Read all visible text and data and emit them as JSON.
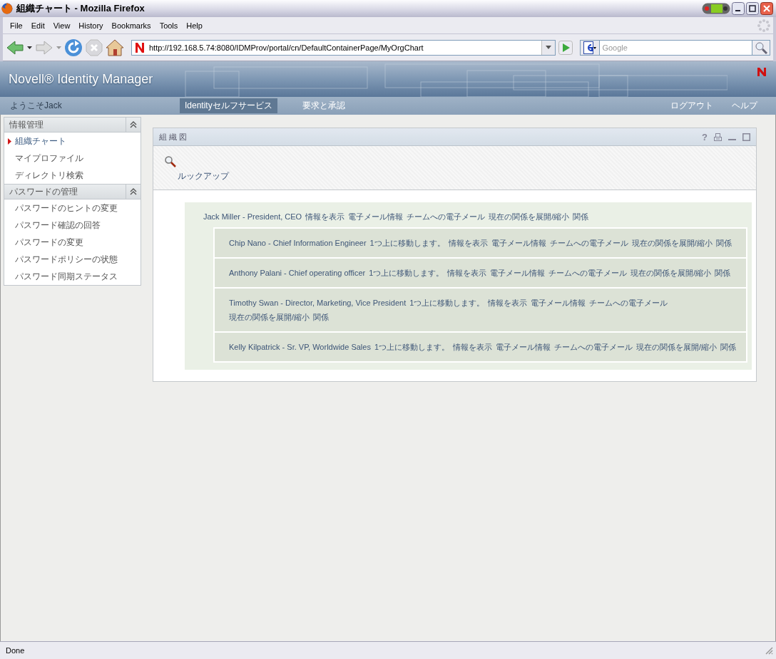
{
  "window": {
    "title": "組織チャート - Mozilla Firefox"
  },
  "menu": [
    "File",
    "Edit",
    "View",
    "History",
    "Bookmarks",
    "Tools",
    "Help"
  ],
  "toolbar": {
    "url": "http://192.168.5.74:8080/IDMProv/portal/cn/DefaultContainerPage/MyOrgChart",
    "search_placeholder": "Google"
  },
  "portal": {
    "brand": "Novell® Identity Manager",
    "welcome": "ようこそJack",
    "nav": [
      {
        "label": "Identityセルフサービス",
        "selected": true
      },
      {
        "label": "要求と承認",
        "selected": false
      }
    ],
    "links": [
      "ログアウト",
      "ヘルプ"
    ]
  },
  "sidebar": {
    "sections": [
      {
        "title": "情報管理",
        "expanded": true,
        "items": [
          {
            "label": "組織チャート",
            "selected": true
          },
          {
            "label": "マイプロファイル",
            "selected": false
          },
          {
            "label": "ディレクトリ検索",
            "selected": false
          }
        ]
      },
      {
        "title": "パスワードの管理",
        "expanded": true,
        "items": [
          {
            "label": "パスワードのヒントの変更",
            "selected": false
          },
          {
            "label": "パスワード確認の回答",
            "selected": false
          },
          {
            "label": "パスワードの変更",
            "selected": false
          },
          {
            "label": "パスワードポリシーの状態",
            "selected": false
          },
          {
            "label": "パスワード同期ステータス",
            "selected": false
          }
        ]
      }
    ]
  },
  "portlet": {
    "title": "組 織 図",
    "help": "?",
    "lookup": "ルックアップ",
    "manager": {
      "name": "Jack Miller - President, CEO",
      "links": [
        "情報を表示",
        "電子メール情報",
        "チームへの電子メール",
        "現在の関係を展開/縮小",
        "関係"
      ]
    },
    "reports": [
      {
        "name": "Chip Nano - Chief Information Engineer",
        "links": [
          "1つ上に移動します。",
          "情報を表示",
          "電子メール情報",
          "チームへの電子メール",
          "現在の関係を展開/縮小",
          "関係"
        ]
      },
      {
        "name": "Anthony Palani - Chief operating officer",
        "links": [
          "1つ上に移動します。",
          "情報を表示",
          "電子メール情報",
          "チームへの電子メール",
          "現在の関係を展開/縮小",
          "関係"
        ]
      },
      {
        "name": "Timothy Swan - Director, Marketing, Vice President",
        "links": [
          "1つ上に移動します。",
          "情報を表示",
          "電子メール情報",
          "チームへの電子メール",
          "現在の関係を展開/縮小",
          "関係"
        ]
      },
      {
        "name": "Kelly Kilpatrick - Sr. VP, Worldwide Sales",
        "links": [
          "1つ上に移動します。",
          "情報を表示",
          "電子メール情報",
          "チームへの電子メール",
          "現在の関係を展開/縮小",
          "関係"
        ]
      }
    ]
  },
  "status": "Done"
}
